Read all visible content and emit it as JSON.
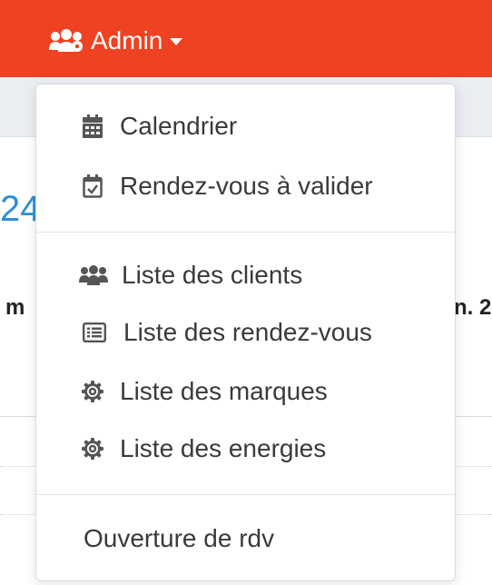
{
  "navbar": {
    "admin_label": "Admin",
    "color": "#ee4222"
  },
  "background": {
    "number_fragment": "24",
    "col_left_fragment": "m",
    "col_right_fragment": "n. 2"
  },
  "dropdown": {
    "items": [
      {
        "label": "Calendrier",
        "icon": "calendar-icon"
      },
      {
        "label": "Rendez-vous à valider",
        "icon": "calendar-check-icon"
      },
      {
        "label": "Liste des clients",
        "icon": "users-icon"
      },
      {
        "label": "Liste des rendez-vous",
        "icon": "list-icon"
      },
      {
        "label": "Liste des marques",
        "icon": "gear-icon"
      },
      {
        "label": "Liste des energies",
        "icon": "gear-icon"
      },
      {
        "label": "Ouverture de rdv",
        "icon": ""
      }
    ]
  }
}
